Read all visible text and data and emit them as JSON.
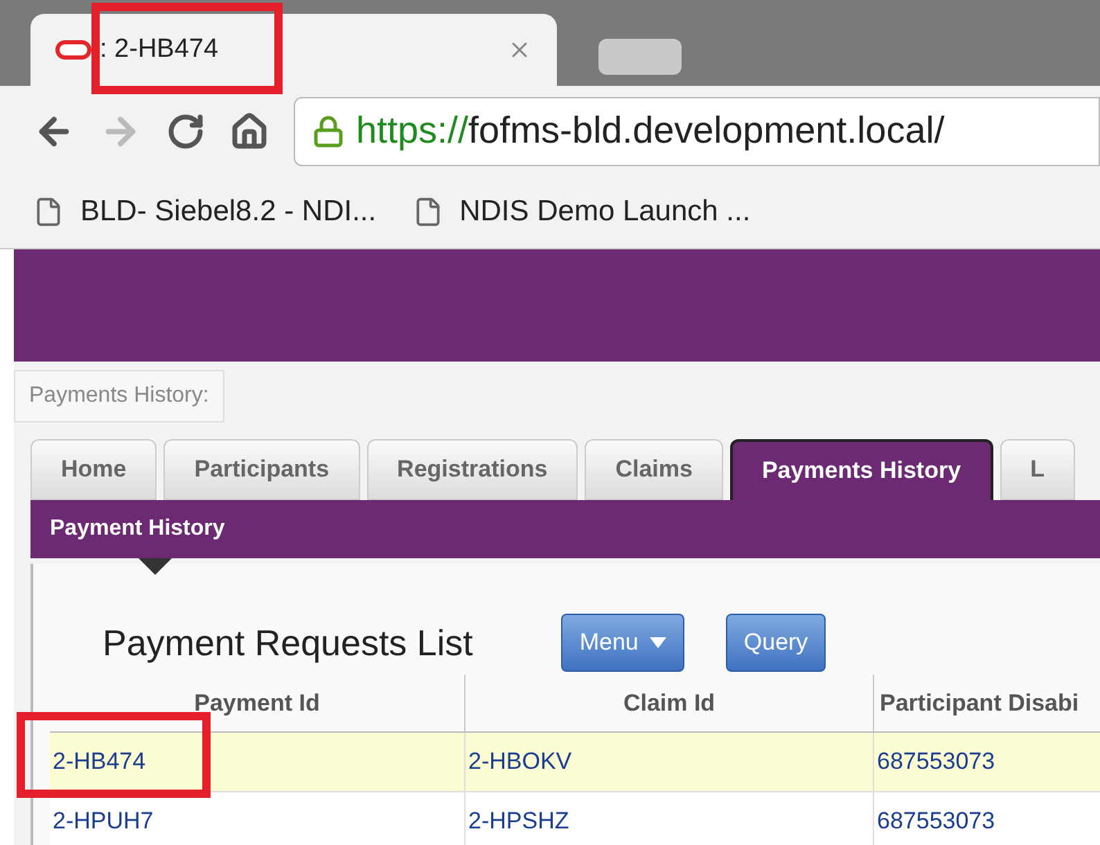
{
  "browser": {
    "tab_title": ": 2-HB474",
    "url_scheme": "https://",
    "url_rest": "fofms-bld.development.local/",
    "bookmarks": [
      "BLD- Siebel8.2 - NDI...",
      "NDIS Demo Launch ..."
    ]
  },
  "breadcrumb": "Payments History:",
  "tabs": [
    {
      "label": "Home",
      "selected": false
    },
    {
      "label": "Participants",
      "selected": false
    },
    {
      "label": "Registrations",
      "selected": false
    },
    {
      "label": "Claims",
      "selected": false
    },
    {
      "label": "Payments History",
      "selected": true
    },
    {
      "label": "L",
      "selected": false
    }
  ],
  "subnav": "Payment History",
  "list": {
    "title": "Payment Requests List",
    "buttons": [
      {
        "label": "Menu",
        "kind": "dropdown"
      },
      {
        "label": "Query",
        "kind": "plain"
      }
    ],
    "columns": [
      "Payment Id",
      "Claim Id",
      "Participant Disabi"
    ],
    "rows": [
      {
        "cells": [
          "2-HB474",
          "2-HBOKV",
          "687553073"
        ],
        "selected": true
      },
      {
        "cells": [
          "2-HPUH7",
          "2-HPSHZ",
          "687553073"
        ],
        "selected": false
      }
    ]
  }
}
